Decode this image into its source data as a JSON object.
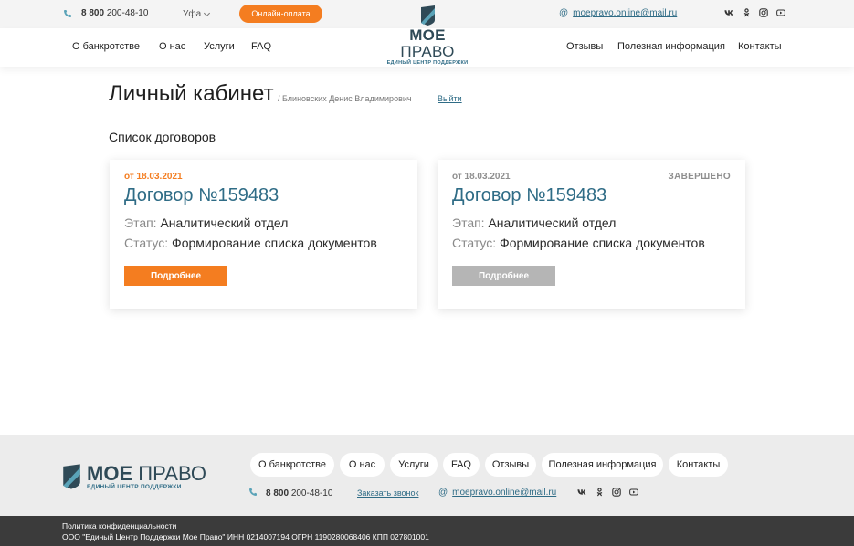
{
  "topbar": {
    "phone_prefix": "8 800",
    "phone_rest": "200-48-10",
    "city": "Уфа",
    "pay_label": "Онлайн-оплата",
    "email": "moepravo.online@mail.ru"
  },
  "logo": {
    "name_bold": "МОЕ",
    "name_light": "ПРАВО",
    "tagline": "ЕДИНЫЙ ЦЕНТР ПОДДЕРЖКИ"
  },
  "nav": {
    "left": [
      "О банкротстве",
      "О нас",
      "Услуги",
      "FAQ"
    ],
    "right": [
      "Отзывы",
      "Полезная информация",
      "Контакты"
    ]
  },
  "page": {
    "title": "Личный кабинет",
    "crumb": "/ Блиновских Денис Владимирович",
    "logout": "Выйти",
    "section_title": "Список договоров"
  },
  "cards": [
    {
      "date": "от 18.03.2021",
      "status_badge": "",
      "contract": "Договор №159483",
      "stage_key": "Этап:",
      "stage_value": "Аналитический отдел",
      "status_key": "Статус:",
      "status_value": "Формирование списка документов",
      "button": "Подробнее",
      "accent": "#f47d20",
      "button_color": "#f47d20"
    },
    {
      "date": "от 18.03.2021",
      "status_badge": "ЗАВЕРШЕНО",
      "contract": "Договор №159483",
      "stage_key": "Этап:",
      "stage_value": "Аналитический отдел",
      "status_key": "Статус:",
      "status_value": "Формирование списка документов",
      "button": "Подробнее",
      "accent": "#8e8e8e",
      "button_color": "#b5b5b5"
    }
  ],
  "footer": {
    "nav": [
      "О банкротстве",
      "О нас",
      "Услуги",
      "FAQ",
      "Отзывы",
      "Полезная информация",
      "Контакты"
    ],
    "phone_prefix": "8 800",
    "phone_rest": "200-48-10",
    "callback": "Заказать звонок",
    "email": "moepravo.online@mail.ru",
    "privacy": "Политика конфиденциальности",
    "legal": "ООО \"Единый Центр Поддержки Мое Право\" ИНН 0214007194 ОГРН 1190280068406 КПП 027801001"
  },
  "socials": [
    "vk-icon",
    "odnoklassniki-icon",
    "instagram-icon",
    "youtube-icon"
  ],
  "colors": {
    "brand": "#2f6c86",
    "accent": "#f47d20",
    "muted_button": "#b5b5b5"
  }
}
